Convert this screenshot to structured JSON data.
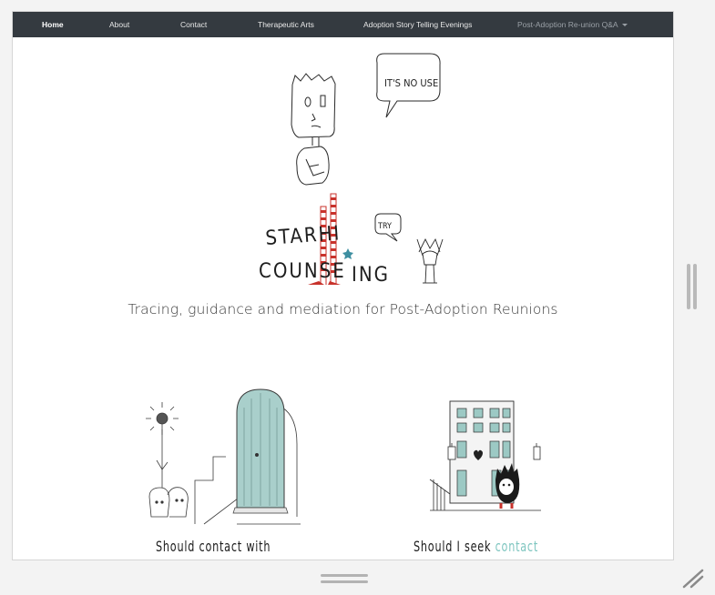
{
  "nav": {
    "items": [
      {
        "label": "Home",
        "active": true
      },
      {
        "label": "About"
      },
      {
        "label": "Contact"
      },
      {
        "label": "Therapeutic Arts"
      },
      {
        "label": "Adoption Story Telling Evenings"
      },
      {
        "label": "Post-Adoption Re-union Q&A",
        "dropdown": true
      }
    ]
  },
  "logo": {
    "speech_large": "IT'S NO USE",
    "speech_small": "TRY",
    "wordmark_line1": "STARHI",
    "wordmark_line2_a": "COUNSE",
    "wordmark_line2_b": "ING"
  },
  "tagline": "Tracing, guidance and mediation for Post-Adoption Reunions",
  "cards": [
    {
      "title": "Should contact with"
    },
    {
      "title_prefix": "Should I seek",
      "title_accent": "contact"
    }
  ],
  "colors": {
    "nav_bg": "#343a40",
    "accent": "#7fc6c0",
    "door_teal": "#9cc9c4",
    "stripe_red": "#c8322b"
  },
  "icons": [
    "scrollbar-grip-icon",
    "resize-grip-icon",
    "dropdown-caret-icon"
  ]
}
